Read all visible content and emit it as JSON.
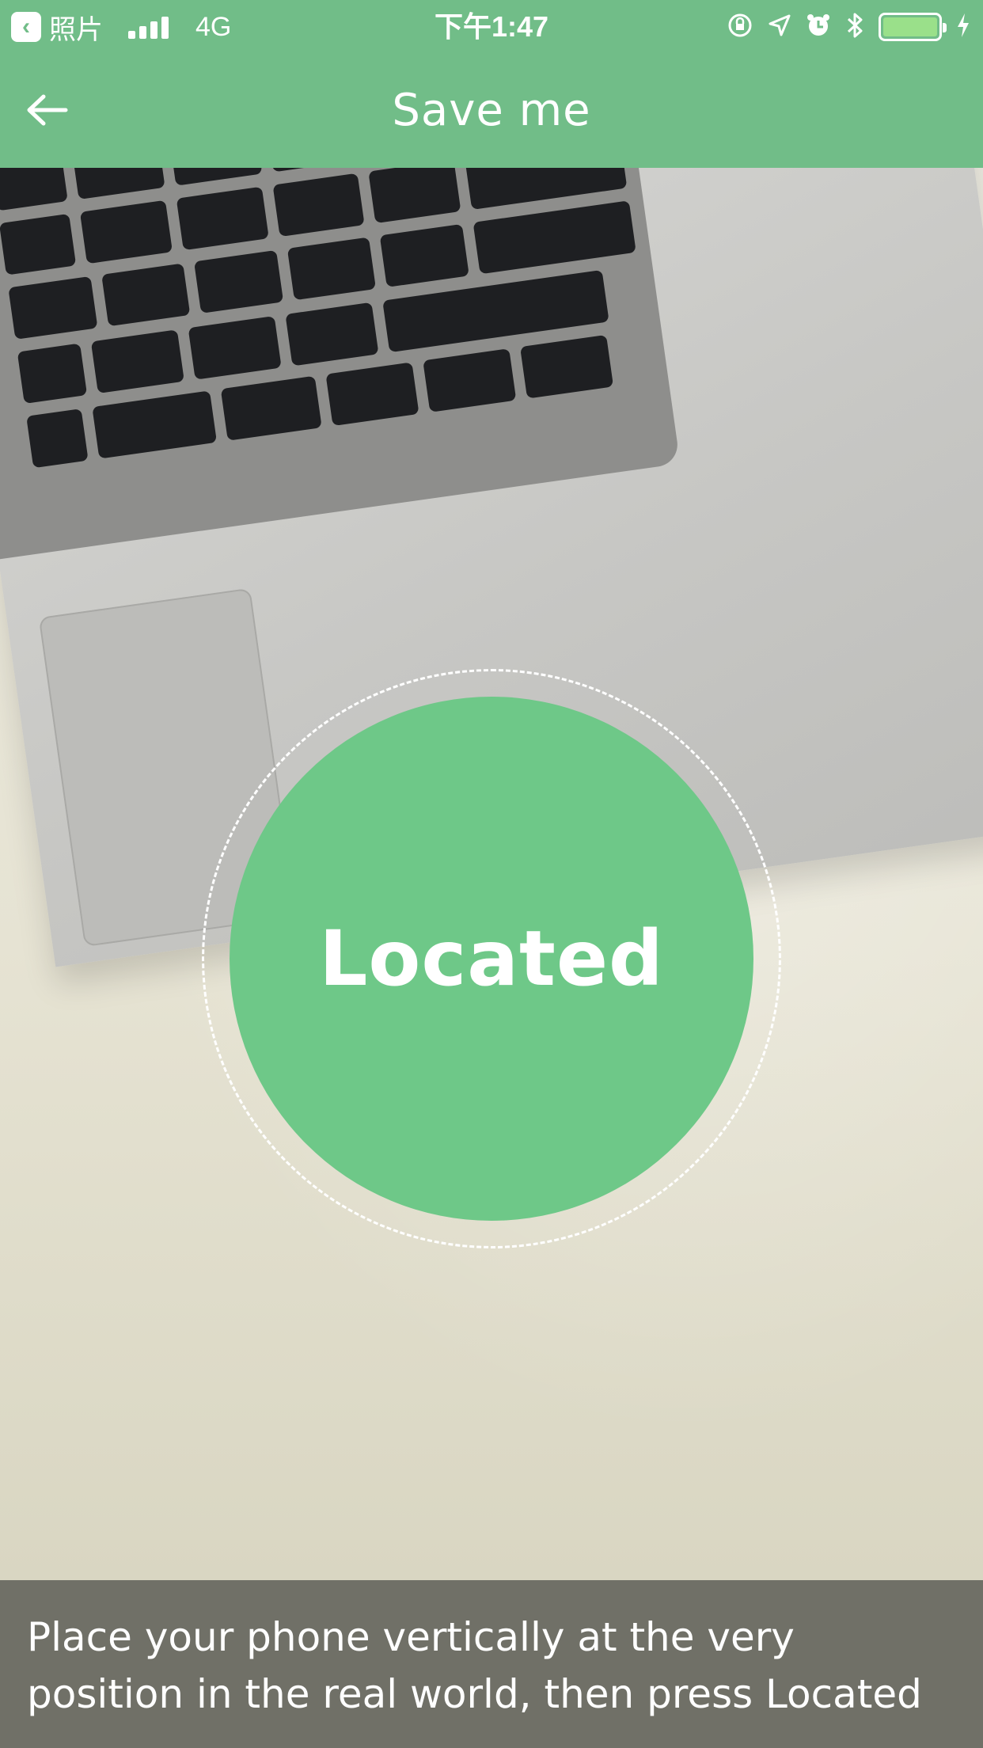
{
  "status_bar": {
    "back_app_label": "照片",
    "carrier": "4G",
    "time": "下午1:47",
    "icons": [
      "rotation-lock-icon",
      "location-arrow-icon",
      "alarm-icon",
      "bluetooth-icon",
      "battery-icon",
      "charging-icon"
    ],
    "battery_color": "#9ae08a"
  },
  "nav": {
    "title": "Save me",
    "back_icon": "arrow-left-icon",
    "background": "#71bd88"
  },
  "camera": {
    "located_label": "Located",
    "button_color": "#6ec888"
  },
  "instruction": {
    "line1": "Place your phone vertically at the very",
    "line2": "position in the real world, then press Located"
  }
}
